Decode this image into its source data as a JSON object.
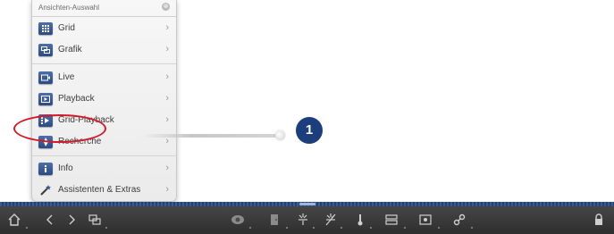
{
  "menu": {
    "title": "Ansichten-Auswahl",
    "close_symbol": "⊗",
    "items": [
      {
        "label": "Grid",
        "icon": "grid-icon"
      },
      {
        "label": "Grafik",
        "icon": "graphic-icon"
      },
      {
        "label": "Live",
        "icon": "live-icon"
      },
      {
        "label": "Playback",
        "icon": "playback-icon"
      },
      {
        "label": "Grid-Playback",
        "icon": "grid-playback-icon"
      },
      {
        "label": "Recherche",
        "icon": "search-icon"
      },
      {
        "label": "Info",
        "icon": "info-icon"
      },
      {
        "label": "Assistenten & Extras",
        "icon": "wand-icon"
      }
    ],
    "chevron": "›"
  },
  "callout": {
    "number": "1"
  },
  "toolbar": {
    "icons": [
      "home-icon",
      "back-icon",
      "forward-icon",
      "layout-icon",
      "camera-dome-icon",
      "door-icon",
      "light-on-icon",
      "light-off-icon",
      "thermometer-icon",
      "toggle-icon",
      "snapshot-icon",
      "link-icon",
      "lock-icon"
    ]
  },
  "colors": {
    "accent": "#1c3e7d",
    "highlight": "#d11a2a",
    "menu_icon": "#2b4a83"
  }
}
